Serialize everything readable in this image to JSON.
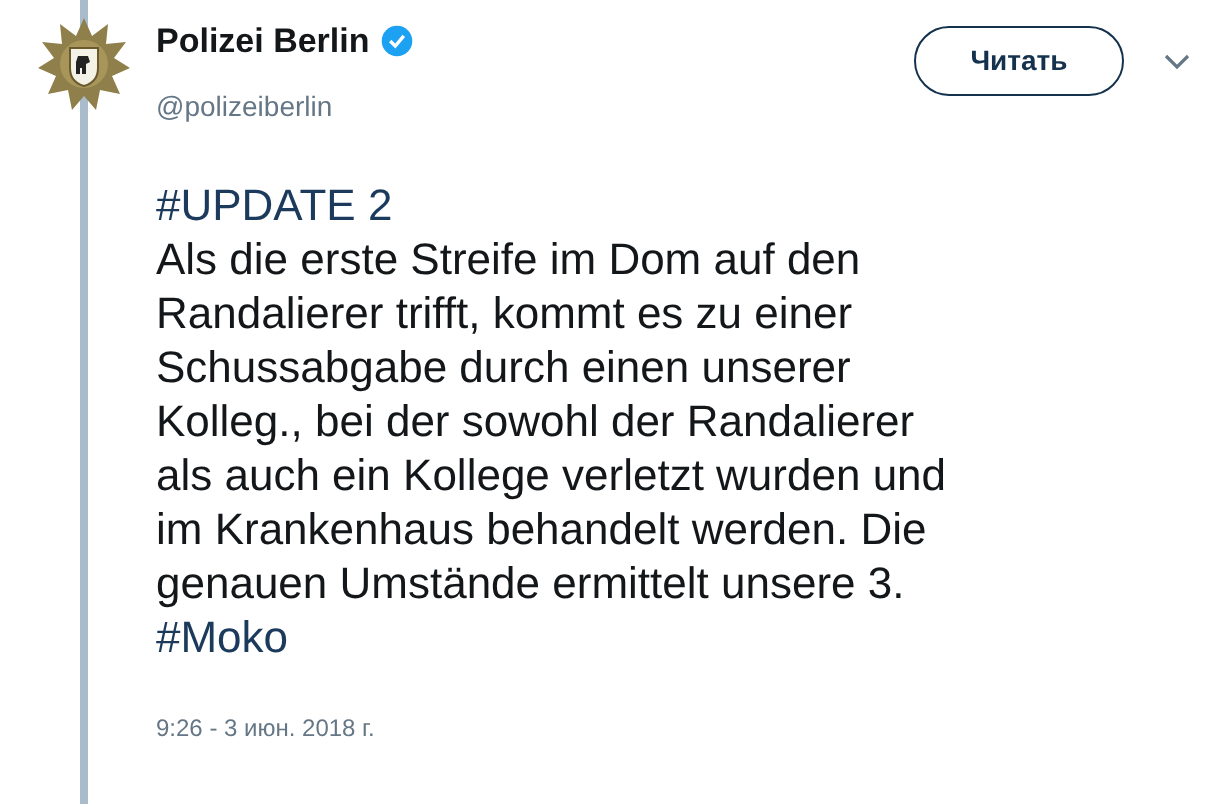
{
  "author": {
    "name": "Polizei Berlin",
    "verified": true,
    "handle": "@polizeiberlin"
  },
  "follow_button": {
    "label": "Читать"
  },
  "tweet": {
    "segments": [
      {
        "kind": "hashtag",
        "text": "#UPDATE 2"
      },
      {
        "kind": "text",
        "text": "\nAls die erste Streife im Dom auf den\nRandalierer trifft, kommt es zu einer\nSchussabgabe durch einen unserer\nKolleg., bei der sowohl der Randalierer\nals auch ein Kollege verletzt wurden und\nim Krankenhaus behandelt werden. Die\ngenauen Umstände ermittelt unsere 3.\n"
      },
      {
        "kind": "hashtag",
        "text": "#Moko"
      }
    ],
    "timestamp": "9:26 - 3 июн. 2018 г."
  }
}
